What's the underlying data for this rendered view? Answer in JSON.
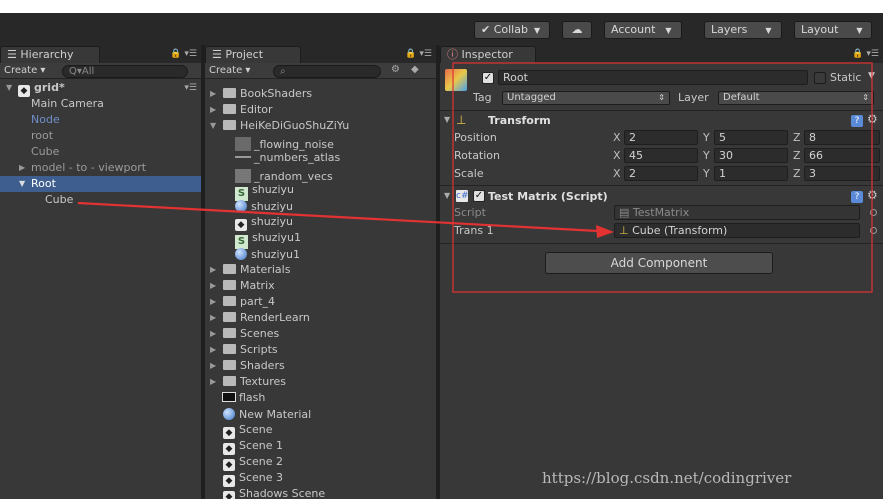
{
  "watermark": "https://blog.csdn.net/codingriver",
  "toolbar": {
    "collab": "Collab",
    "account": "Account",
    "layers": "Layers",
    "layout": "Layout",
    "cloud_icon": "cloud-icon"
  },
  "hierarchy": {
    "tab": "Hierarchy",
    "create": "Create",
    "search_placeholder": "Q▾All",
    "scene": "grid*",
    "items": [
      "Main Camera",
      "Node",
      "root",
      "Cube",
      "model - to - viewport",
      "Root",
      "Cube"
    ]
  },
  "project": {
    "tab": "Project",
    "create": "Create",
    "folders_top": [
      "BookShaders",
      "Editor",
      "HeiKeDiGuoShuZiYu"
    ],
    "subitems": [
      "_flowing_noise",
      "_numbers_atlas",
      "_random_vecs",
      "shuziyu",
      "shuziyu",
      "shuziyu",
      "shuziyu1",
      "shuziyu1"
    ],
    "folders": [
      "Materials",
      "Matrix",
      "part_4",
      "RenderLearn",
      "Scenes",
      "Scripts",
      "Shaders",
      "Textures"
    ],
    "assets": [
      "flash",
      "New Material",
      "Scene",
      "Scene 1",
      "Scene 2",
      "Scene 3",
      "Shadows Scene"
    ]
  },
  "inspector": {
    "tab": "Inspector",
    "object_name": "Root",
    "static_label": "Static",
    "tag_label": "Tag",
    "tag_value": "Untagged",
    "layer_label": "Layer",
    "layer_value": "Default",
    "transform": {
      "title": "Transform",
      "position_label": "Position",
      "rotation_label": "Rotation",
      "scale_label": "Scale",
      "x": "X",
      "y": "Y",
      "z": "Z",
      "position": [
        "2",
        "5",
        "8"
      ],
      "rotation": [
        "45",
        "30",
        "66"
      ],
      "scale": [
        "2",
        "1",
        "3"
      ]
    },
    "script_component": {
      "title": "Test Matrix (Script)",
      "script_label": "Script",
      "script_value": "TestMatrix",
      "trans_label": "Trans 1",
      "trans_value": "Cube (Transform)"
    },
    "add_component": "Add Component"
  },
  "colors": {
    "annotation_red": "#e23232",
    "selection_blue": "#3d5e8e"
  }
}
